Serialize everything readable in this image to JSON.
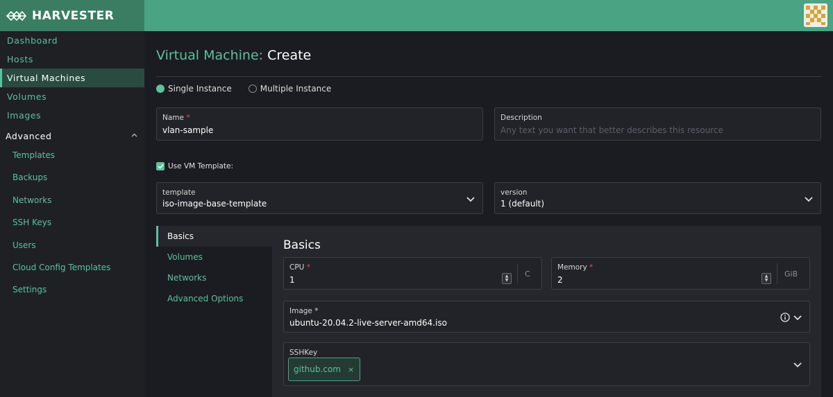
{
  "brand": {
    "name": "HARVESTER"
  },
  "sidebar": {
    "items": [
      {
        "label": "Dashboard"
      },
      {
        "label": "Hosts"
      },
      {
        "label": "Virtual Machines"
      },
      {
        "label": "Volumes"
      },
      {
        "label": "Images"
      }
    ],
    "group": {
      "label": "Advanced"
    },
    "advanced_items": [
      {
        "label": "Templates"
      },
      {
        "label": "Backups"
      },
      {
        "label": "Networks"
      },
      {
        "label": "SSH Keys"
      },
      {
        "label": "Users"
      },
      {
        "label": "Cloud Config Templates"
      },
      {
        "label": "Settings"
      }
    ]
  },
  "page": {
    "title_prefix": "Virtual Machine:",
    "title_action": "Create"
  },
  "instance_mode": {
    "single": "Single Instance",
    "multiple": "Multiple Instance",
    "selected": "Single Instance"
  },
  "form": {
    "name": {
      "label": "Name",
      "required_mark": "*",
      "value": "vlan-sample"
    },
    "description": {
      "label": "Description",
      "placeholder": "Any text you want that better describes this resource"
    },
    "use_template": {
      "label": "Use VM Template:",
      "checked": true
    },
    "template": {
      "label": "template",
      "value": "iso-image-base-template"
    },
    "version": {
      "label": "version",
      "value": "1 (default)"
    }
  },
  "tabs": [
    {
      "label": "Basics"
    },
    {
      "label": "Volumes"
    },
    {
      "label": "Networks"
    },
    {
      "label": "Advanced Options"
    }
  ],
  "basics": {
    "title": "Basics",
    "cpu": {
      "label": "CPU",
      "required_mark": "*",
      "value": "1",
      "unit": "C"
    },
    "memory": {
      "label": "Memory",
      "required_mark": "*",
      "value": "2",
      "unit": "GiB"
    },
    "image": {
      "label": "Image *",
      "value": "ubuntu-20.04.2-live-server-amd64.iso"
    },
    "sshkey": {
      "label": "SSHKey",
      "tags": [
        {
          "label": "github.com",
          "remove": "×"
        }
      ]
    }
  },
  "colors": {
    "accent": "#5cc19d",
    "header": "#4aa383",
    "brand_bg": "#3b7d63",
    "background": "#1b1c21",
    "required": "#e0505a"
  }
}
